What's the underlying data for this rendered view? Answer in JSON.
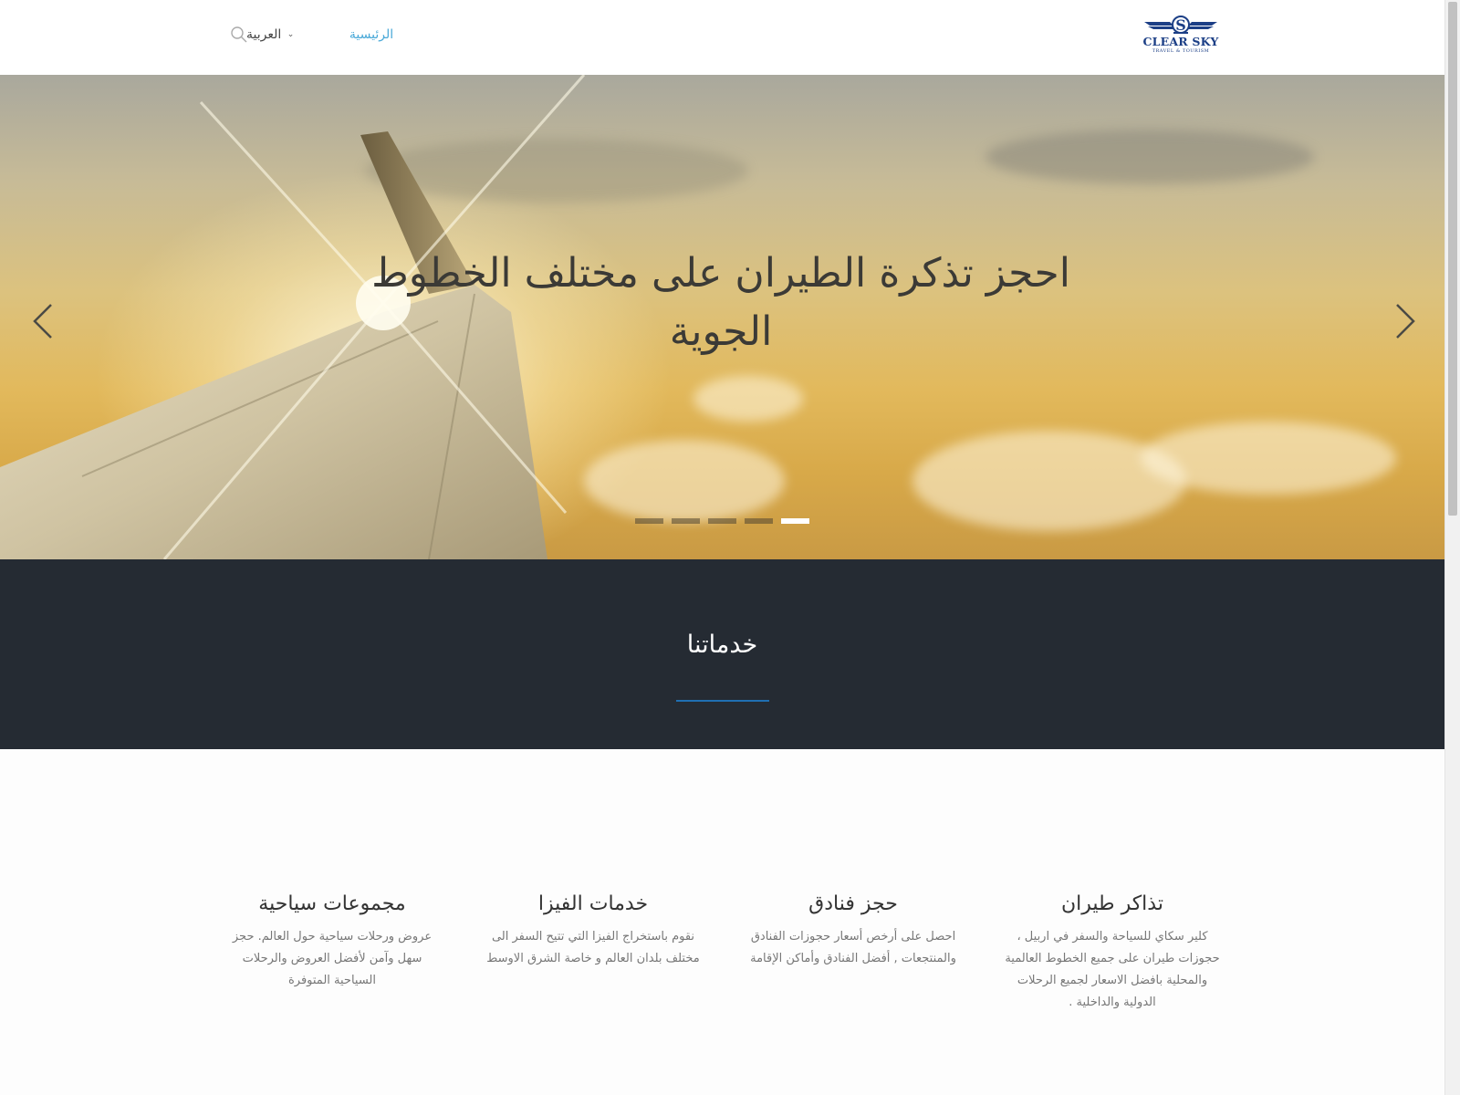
{
  "header": {
    "logo": {
      "text": "CLEAR SKY",
      "subtext": "TRAVEL & TOURISM"
    },
    "nav": {
      "home_label": "الرئيسية"
    },
    "language": {
      "label": "العربية"
    },
    "search_icon": "search-icon"
  },
  "hero": {
    "title": "احجز تذكرة الطيران على مختلف الخطوط الجوية",
    "slide_count": 5,
    "active_slide": 5
  },
  "services": {
    "heading": "خدماتنا",
    "accent_color": "#1f6fb2",
    "items": [
      {
        "title": "تذاكر طيران",
        "text": "كلير سكاي للسياحة والسفر  في اربيل ، حجوزات طيران على جميع الخطوط العالمية والمحلية بافضل الاسعار لجميع الرحلات الدولية والداخلية ."
      },
      {
        "title": "حجز فنادق",
        "text": "احصل على أرخص أسعار حجوزات الفنادق والمنتجعات , أفضل الفنادق وأماكن الإقامة"
      },
      {
        "title": "خدمات الفيزا",
        "text": "نقوم باستخراج الفيزا التي تتيح السفر الى مختلف بلدان العالم و خاصة الشرق الاوسط"
      },
      {
        "title": "مجموعات سياحية",
        "text": "عروض ورحلات سياحية حول العالم. حجز سهل وآمن لأفضل العروض والرحلات السياحية المتوفرة"
      }
    ]
  },
  "colors": {
    "nav_link": "#4aa9d8",
    "band_background": "#252b33",
    "logo_blue": "#1c3f86"
  }
}
